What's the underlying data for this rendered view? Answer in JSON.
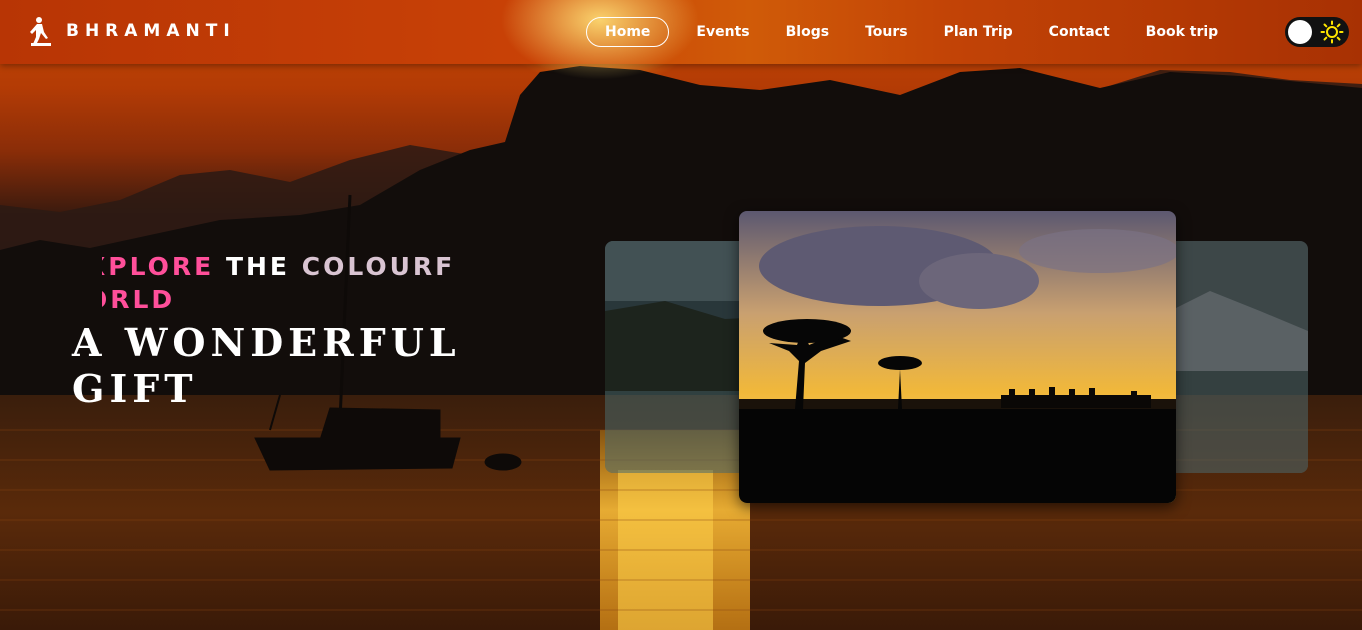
{
  "brand": {
    "name": "BHRAMANTI",
    "logo_icon": "hiker-icon"
  },
  "nav": {
    "items": [
      {
        "label": "Home",
        "active": true
      },
      {
        "label": "Events",
        "active": false
      },
      {
        "label": "Blogs",
        "active": false
      },
      {
        "label": "Tours",
        "active": false
      },
      {
        "label": "Plan Trip",
        "active": false
      },
      {
        "label": "Contact",
        "active": false
      },
      {
        "label": "Book trip",
        "active": false
      }
    ],
    "theme_toggle": {
      "icon": "sun-icon",
      "mode": "light"
    }
  },
  "hero": {
    "tagline_line1": {
      "w1": "XPLORE",
      "w2": "THE",
      "w3": "COLOURF"
    },
    "tagline_line2": "ORLD",
    "headline_line1": "A WONDERFUL",
    "headline_line2": "GIFT"
  },
  "carousel": {
    "slides": [
      "mountain-lake-left",
      "savanna-sunset",
      "mountain-lake-right"
    ],
    "active_slide": 1
  },
  "colors": {
    "accent_pink": "#ff4f9a",
    "navbar": "#c24306",
    "toggle_bg": "#111111",
    "sun_yellow": "#ffe600"
  }
}
